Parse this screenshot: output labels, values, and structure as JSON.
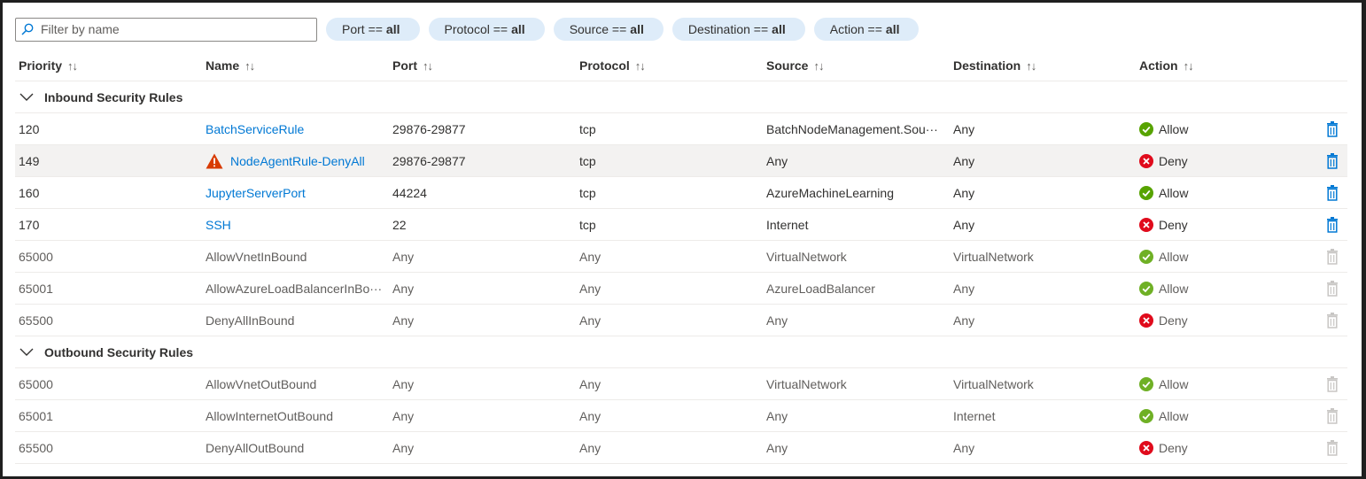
{
  "filters": {
    "search_placeholder": "Filter by name",
    "pills": [
      {
        "label": "Port ==",
        "value": "all"
      },
      {
        "label": "Protocol ==",
        "value": "all"
      },
      {
        "label": "Source ==",
        "value": "all"
      },
      {
        "label": "Destination ==",
        "value": "all"
      },
      {
        "label": "Action ==",
        "value": "all"
      }
    ]
  },
  "columns": {
    "priority": "Priority",
    "name": "Name",
    "port": "Port",
    "protocol": "Protocol",
    "source": "Source",
    "destination": "Destination",
    "action": "Action",
    "sort_glyph": "↑↓"
  },
  "groups": {
    "inbound": {
      "label": "Inbound Security Rules",
      "rows": [
        {
          "priority": "120",
          "name": "BatchServiceRule",
          "port": "29876-29877",
          "protocol": "tcp",
          "source": "BatchNodeManagement.Sou···",
          "destination": "Any",
          "action": "Allow"
        },
        {
          "priority": "149",
          "name": "NodeAgentRule-DenyAll",
          "port": "29876-29877",
          "protocol": "tcp",
          "source": "Any",
          "destination": "Any",
          "action": "Deny"
        },
        {
          "priority": "160",
          "name": "JupyterServerPort",
          "port": "44224",
          "protocol": "tcp",
          "source": "AzureMachineLearning",
          "destination": "Any",
          "action": "Allow"
        },
        {
          "priority": "170",
          "name": "SSH",
          "port": "22",
          "protocol": "tcp",
          "source": "Internet",
          "destination": "Any",
          "action": "Deny"
        },
        {
          "priority": "65000",
          "name": "AllowVnetInBound",
          "port": "Any",
          "protocol": "Any",
          "source": "VirtualNetwork",
          "destination": "VirtualNetwork",
          "action": "Allow"
        },
        {
          "priority": "65001",
          "name": "AllowAzureLoadBalancerInBo···",
          "port": "Any",
          "protocol": "Any",
          "source": "AzureLoadBalancer",
          "destination": "Any",
          "action": "Allow"
        },
        {
          "priority": "65500",
          "name": "DenyAllInBound",
          "port": "Any",
          "protocol": "Any",
          "source": "Any",
          "destination": "Any",
          "action": "Deny"
        }
      ]
    },
    "outbound": {
      "label": "Outbound Security Rules",
      "rows": [
        {
          "priority": "65000",
          "name": "AllowVnetOutBound",
          "port": "Any",
          "protocol": "Any",
          "source": "VirtualNetwork",
          "destination": "VirtualNetwork",
          "action": "Allow"
        },
        {
          "priority": "65001",
          "name": "AllowInternetOutBound",
          "port": "Any",
          "protocol": "Any",
          "source": "Any",
          "destination": "Internet",
          "action": "Allow"
        },
        {
          "priority": "65500",
          "name": "DenyAllOutBound",
          "port": "Any",
          "protocol": "Any",
          "source": "Any",
          "destination": "Any",
          "action": "Deny"
        }
      ]
    }
  },
  "colors": {
    "link": "#0078d4",
    "allow": "#57a300",
    "deny": "#e00b1c",
    "warning": "#d83b01",
    "pill_bg": "#deecf9"
  },
  "icons": {
    "search": "search-icon",
    "chevron": "chevron-down-icon",
    "allow": "check-circle-icon",
    "deny": "error-circle-icon",
    "warning": "warning-icon",
    "delete": "trash-icon"
  }
}
